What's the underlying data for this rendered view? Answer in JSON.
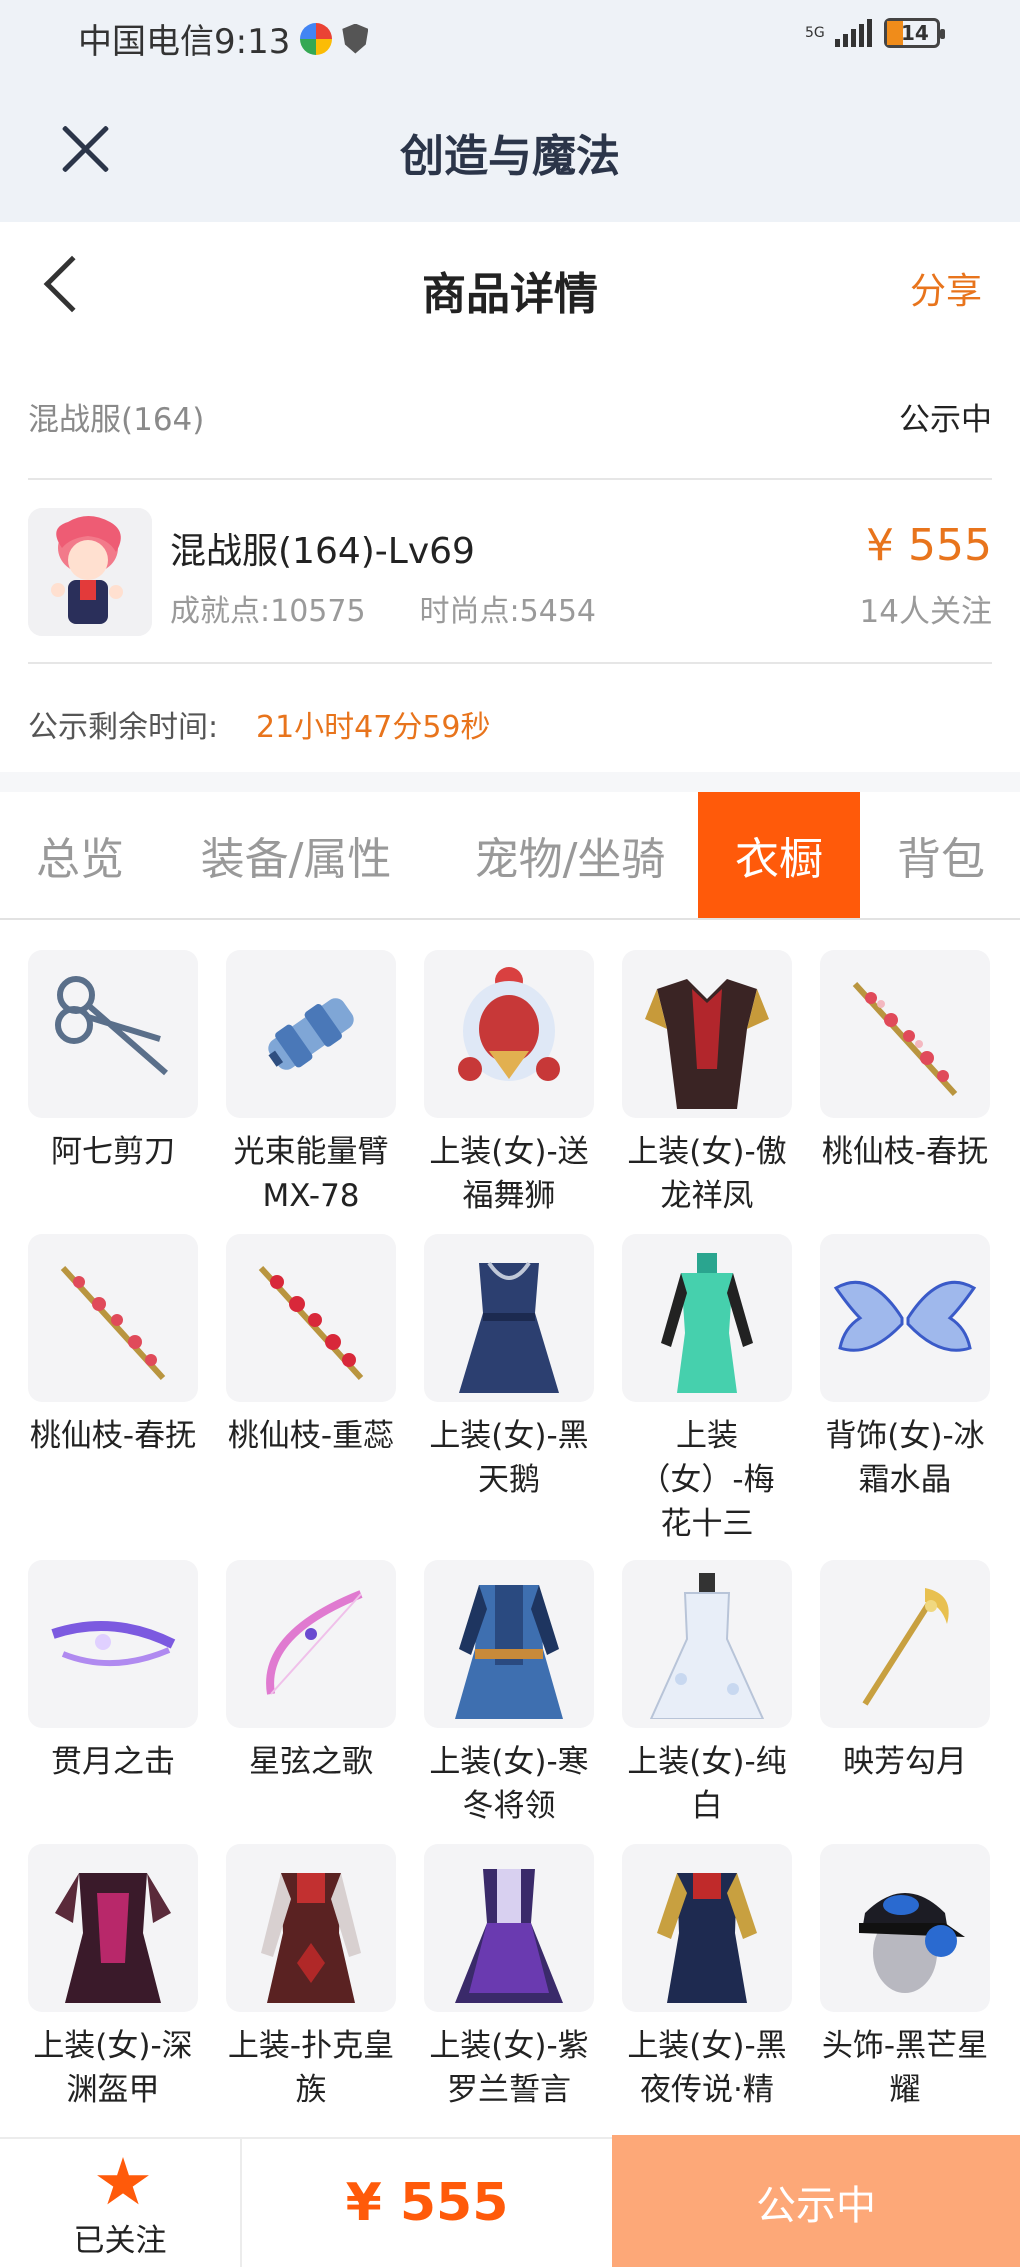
{
  "status_bar": {
    "carrier_time": "中国电信9:13",
    "network": "5G",
    "battery": "14"
  },
  "app_bar": {
    "title": "创造与魔法"
  },
  "page_header": {
    "title": "商品详情",
    "share": "分享"
  },
  "product": {
    "server": "混战服(164)",
    "status": "公示中",
    "name": "混战服(164)-Lv69",
    "achievement": "成就点:10575",
    "fashion": "时尚点:5454",
    "price": "¥ 555",
    "followers": "14人关注",
    "countdown_label": "公示剩余时间:",
    "countdown_value": "21小时47分59秒"
  },
  "tabs": [
    {
      "label": "总览",
      "active": false
    },
    {
      "label": "装备/属性",
      "active": false
    },
    {
      "label": "宠物/坐骑",
      "active": false
    },
    {
      "label": "衣橱",
      "active": true
    },
    {
      "label": "背包",
      "active": false
    }
  ],
  "items": [
    {
      "label": "阿七剪刀",
      "icon": "scissors-icon"
    },
    {
      "label": "光束能量臂MX-78",
      "icon": "energy-arm-icon"
    },
    {
      "label": "上装(女)-送福舞狮",
      "icon": "outfit-lion-icon"
    },
    {
      "label": "上装(女)-傲龙祥凤",
      "icon": "outfit-dragon-icon"
    },
    {
      "label": "桃仙枝-春抚",
      "icon": "peach-branch-icon"
    },
    {
      "label": "桃仙枝-春抚",
      "icon": "peach-branch-icon"
    },
    {
      "label": "桃仙枝-重蕊",
      "icon": "peach-branch-icon"
    },
    {
      "label": "上装(女)-黑天鹅",
      "icon": "outfit-black-swan-icon"
    },
    {
      "label": "上装\n（女）-梅\n花十三",
      "icon": "outfit-qipao-icon"
    },
    {
      "label": "背饰(女)-冰霜水晶",
      "icon": "ice-wings-icon"
    },
    {
      "label": "贯月之击",
      "icon": "crossbow-icon"
    },
    {
      "label": "星弦之歌",
      "icon": "bow-icon"
    },
    {
      "label": "上装(女)-寒冬将领",
      "icon": "outfit-winter-general-icon"
    },
    {
      "label": "上装(女)-纯白",
      "icon": "outfit-white-dress-icon"
    },
    {
      "label": "映芳勾月",
      "icon": "moon-staff-icon"
    },
    {
      "label": "上装(女)-深渊盔甲",
      "icon": "outfit-abyss-armor-icon"
    },
    {
      "label": "上装-扑克皇族",
      "icon": "outfit-poker-icon"
    },
    {
      "label": "上装(女)-紫罗兰誓言",
      "icon": "outfit-violet-icon"
    },
    {
      "label": "上装(女)-黑夜传说·精",
      "icon": "outfit-night-icon"
    },
    {
      "label": "头饰-黑芒星耀",
      "icon": "cap-headphones-icon"
    }
  ],
  "bottom_bar": {
    "follow_label": "已关注",
    "price": "¥ 555",
    "status_button": "公示中"
  },
  "colors": {
    "accent": "#ff5a0a",
    "price": "#e8741c",
    "button": "#fda878"
  }
}
